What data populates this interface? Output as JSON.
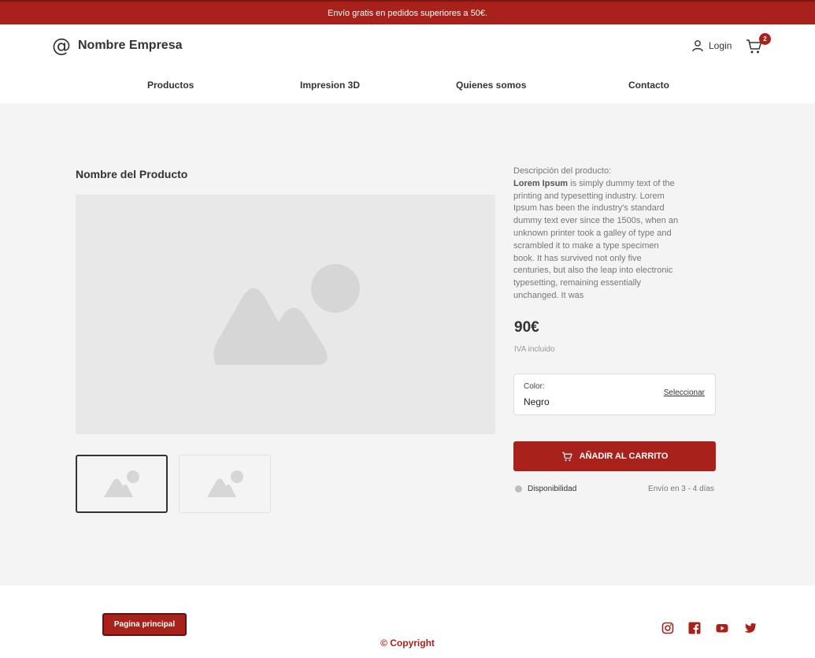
{
  "colors": {
    "accent": "#a8221b",
    "background_main": "#f4f4f4",
    "placeholder": "#d8d8d8"
  },
  "promo": {
    "text": "Envío gratis en pedidos superiores a 50€."
  },
  "header": {
    "brand_icon": "at-sign-icon",
    "brand_name": "Nombre Empresa",
    "login_label": "Login",
    "cart_count": "2"
  },
  "nav": {
    "items": [
      {
        "label": "Productos"
      },
      {
        "label": "Impresion 3D"
      },
      {
        "label": "Quienes somos"
      },
      {
        "label": "Contacto"
      }
    ]
  },
  "product": {
    "title": "Nombre del Producto",
    "description_label": "Descripción del producto:",
    "description_bold": "Lorem Ipsum",
    "description_text": " is simply dummy text of the printing and typesetting industry. Lorem Ipsum has been the industry's standard dummy text ever since the 1500s, when an unknown printer took a galley of type and scrambled it to make a type specimen book. It has survived not only five centuries, but also the leap into electronic typesetting, remaining essentially unchanged. It was",
    "price": "90€",
    "tax_note": "IVA incluido",
    "color_label": "Color:",
    "color_value": "Negro",
    "color_select": "Seleccionar",
    "add_to_cart": "AÑADIR AL CARRITO",
    "availability": "Disponibilidad",
    "shipping": "Envío en 3 - 4 días"
  },
  "footer": {
    "home_button": "Pagina principal",
    "copyright": "© Copyright",
    "social": [
      "instagram-icon",
      "facebook-icon",
      "youtube-icon",
      "twitter-icon"
    ]
  }
}
